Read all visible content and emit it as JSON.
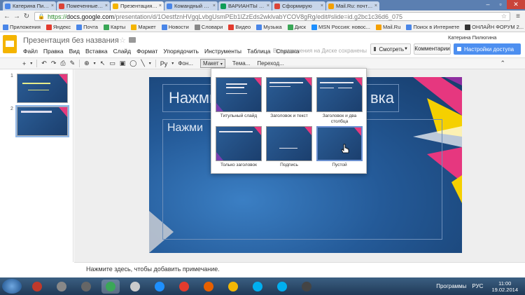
{
  "browser": {
    "tabs": [
      {
        "label": "Катерина Пилюго",
        "color": "#4a86e8"
      },
      {
        "label": "Помеченные - Д",
        "color": "#db4437"
      },
      {
        "label": "Презентация без",
        "color": "#f4b400",
        "active": true
      },
      {
        "label": "Командный ссылк",
        "color": "#4a86e8"
      },
      {
        "label": "ВАРИАНТЫ РАСС",
        "color": "#0f9d58"
      },
      {
        "label": "Сформирую",
        "color": "#db4437"
      },
      {
        "label": "Mail.Ru: почта, по",
        "color": "#f4a000"
      }
    ],
    "tab_close": "×",
    "url_scheme": "https://",
    "url_host": "docs.google.com",
    "url_path": "/presentation/d/1OestfznHVgqLvbgUsmPEb1lZzEds2wklvabYCOV8gRg/edit#slide=id.g2bc1c36d6_075",
    "bookmarks": [
      "Приложения",
      "Яндекс",
      "Почта",
      "Карты",
      "Маркет",
      "Новости",
      "Словари",
      "Видео",
      "Музыка",
      "Диск",
      "MSN Россия: новос...",
      "Mail.Ru",
      "Поиск в Интернете",
      "ОНЛАЙН ФОРУМ 2..."
    ]
  },
  "docs": {
    "title": "Презентация без названия",
    "user": "Катерина Пилюгина",
    "menu": [
      "Файл",
      "Правка",
      "Вид",
      "Вставка",
      "Слайд",
      "Формат",
      "Упорядочить",
      "Инструменты",
      "Таблица",
      "Справка"
    ],
    "save_status": "Все изменения на Диске сохранены",
    "present_label": "Смотреть",
    "comments_label": "Комментарии",
    "share_label": "Настройки доступа"
  },
  "toolbar": {
    "font_label": "Ру",
    "background_label": "Фон...",
    "layout_label": "Макет",
    "theme_label": "Тема...",
    "transition_label": "Переход..."
  },
  "filmstrip": {
    "slides": [
      {
        "number": "1"
      },
      {
        "number": "2"
      }
    ]
  },
  "slide": {
    "title_left": "Нажми",
    "title_right": "вка",
    "body_text": "Нажми"
  },
  "layout_menu": {
    "items": [
      {
        "label": "Титульный слайд"
      },
      {
        "label": "Заголовок и текст"
      },
      {
        "label": "Заголовок и два столбца"
      },
      {
        "label": "Только заголовок"
      },
      {
        "label": "Подпись"
      },
      {
        "label": "Пустой"
      }
    ]
  },
  "notes": {
    "placeholder": "Нажмите здесь, чтобы добавить примечание."
  },
  "taskbar": {
    "programs_label": "Программы",
    "language": "РУС",
    "time": "11:00",
    "date": "19.02.2014",
    "apps": [
      {
        "name": "power",
        "color": "#c0392b"
      },
      {
        "name": "media",
        "color": "#888888"
      },
      {
        "name": "camera",
        "color": "#666666"
      },
      {
        "name": "chrome",
        "color": "#3aa757",
        "active": true
      },
      {
        "name": "opera",
        "color": "#cccccc"
      },
      {
        "name": "ie",
        "color": "#1e90ff"
      },
      {
        "name": "yandex",
        "color": "#e33b2e"
      },
      {
        "name": "firefox",
        "color": "#e66000"
      },
      {
        "name": "mail-agent",
        "color": "#f2b705"
      },
      {
        "name": "skype",
        "color": "#00aff0"
      },
      {
        "name": "skype-2",
        "color": "#00aff0"
      },
      {
        "name": "utility",
        "color": "#444444"
      }
    ]
  }
}
